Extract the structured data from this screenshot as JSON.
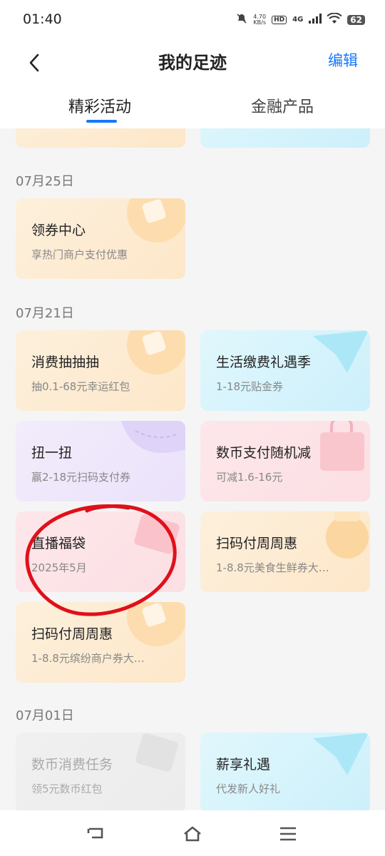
{
  "status_bar": {
    "time": "01:40",
    "net_speed_value": "4.70",
    "net_speed_unit": "KB/s",
    "hd": "HD",
    "network": "4G",
    "battery": "62"
  },
  "header": {
    "title": "我的足迹",
    "edit_label": "编辑"
  },
  "tabs": {
    "active": "精彩活动",
    "other": "金融产品"
  },
  "sections": [
    {
      "date": "07月25日",
      "cards": [
        {
          "title": "领券中心",
          "subtitle": "享热门商户支付优惠",
          "theme": "orange"
        }
      ]
    },
    {
      "date": "07月21日",
      "cards": [
        {
          "title": "消费抽抽抽",
          "subtitle": "抽0.1-68元幸运红包",
          "theme": "orange"
        },
        {
          "title": "生活缴费礼遇季",
          "subtitle": "1-18元贴金券",
          "theme": "cyan"
        },
        {
          "title": "扭一扭",
          "subtitle": "赢2-18元扫码支付券",
          "theme": "purple"
        },
        {
          "title": "数币支付随机减",
          "subtitle": "可减1.6-16元",
          "theme": "pink"
        },
        {
          "title": "直播福袋",
          "subtitle": "2025年5月",
          "theme": "pink"
        },
        {
          "title": "扫码付周周惠",
          "subtitle": "1-8.8元美食生鲜券大…",
          "theme": "orange"
        },
        {
          "title": "扫码付周周惠",
          "subtitle": "1-8.8元缤纷商户券大…",
          "theme": "orange"
        }
      ]
    },
    {
      "date": "07月01日",
      "cards": [
        {
          "title": "数币消费任务",
          "subtitle": "领5元数币红包",
          "theme": "gray"
        },
        {
          "title": "薪享礼遇",
          "subtitle": "代发新人好礼",
          "theme": "cyan"
        }
      ]
    }
  ],
  "colors": {
    "accent": "#1677ff",
    "annotation": "#e0101a"
  },
  "nav": {
    "back_icon": "back-icon",
    "home_icon": "home-icon",
    "menu_icon": "menu-icon"
  }
}
